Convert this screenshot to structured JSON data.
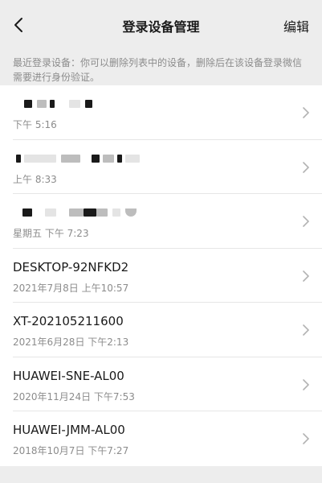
{
  "nav": {
    "title": "登录设备管理",
    "edit_label": "编辑",
    "back_icon": "chevron-left-icon"
  },
  "note": "最近登录设备：你可以删除列表中的设备，删除后在该设备登录微信需要进行身份验证。",
  "devices": [
    {
      "name": "",
      "time": "下午 5:16",
      "redacted": true
    },
    {
      "name": "",
      "time": "上午 8:33",
      "redacted": true
    },
    {
      "name": "",
      "time": "星期五 下午 7:23",
      "redacted": true
    },
    {
      "name": "DESKTOP-92NFKD2",
      "time": "2021年7月8日 上午10:57",
      "redacted": false
    },
    {
      "name": "XT-202105211600",
      "time": "2021年6月28日 下午2:13",
      "redacted": false
    },
    {
      "name": "HUAWEI-SNE-AL00",
      "time": "2020年11月24日 下午7:53",
      "redacted": false
    },
    {
      "name": "HUAWEI-JMM-AL00",
      "time": "2018年10月7日 下午7:27",
      "redacted": false
    }
  ],
  "colors": {
    "background": "#ededed",
    "list_background": "#ffffff",
    "secondary_text": "#8c8c8c",
    "divider": "#e6e6e6"
  }
}
